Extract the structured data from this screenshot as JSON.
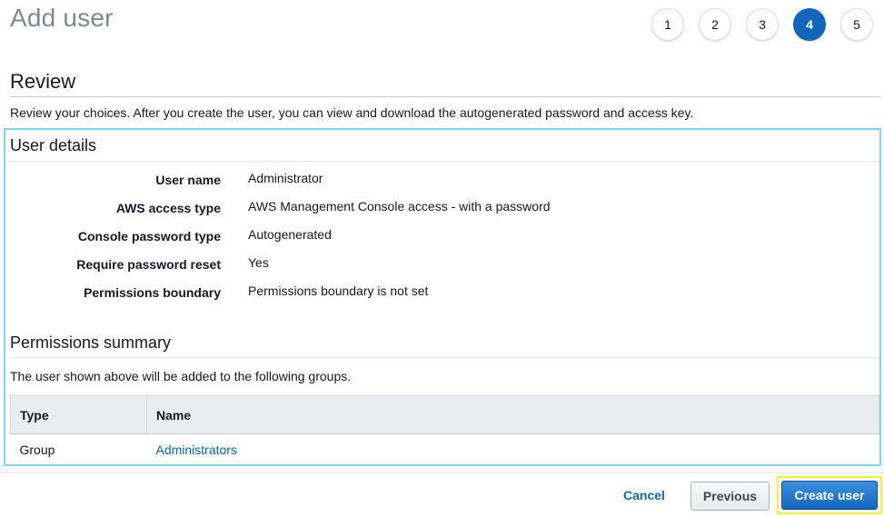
{
  "page": {
    "title": "Add user"
  },
  "steps": [
    {
      "label": "1",
      "active": false
    },
    {
      "label": "2",
      "active": false
    },
    {
      "label": "3",
      "active": false
    },
    {
      "label": "4",
      "active": true
    },
    {
      "label": "5",
      "active": false
    }
  ],
  "review": {
    "title": "Review",
    "intro": "Review your choices. After you create the user, you can view and download the autogenerated password and access key."
  },
  "user_details": {
    "title": "User details",
    "rows": [
      {
        "label": "User name",
        "value": "Administrator"
      },
      {
        "label": "AWS access type",
        "value": "AWS Management Console access - with a password"
      },
      {
        "label": "Console password type",
        "value": "Autogenerated"
      },
      {
        "label": "Require password reset",
        "value": "Yes"
      },
      {
        "label": "Permissions boundary",
        "value": "Permissions boundary is not set"
      }
    ]
  },
  "permissions": {
    "title": "Permissions summary",
    "intro": "The user shown above will be added to the following groups.",
    "columns": [
      "Type",
      "Name"
    ],
    "rows": [
      {
        "type": "Group",
        "name": "Administrators"
      }
    ]
  },
  "footer": {
    "cancel_label": "Cancel",
    "previous_label": "Previous",
    "create_label": "Create user"
  },
  "colors": {
    "accent": "#1166bb",
    "highlight_box": "#7fd6f0",
    "create_highlight": "#f2f22a"
  }
}
